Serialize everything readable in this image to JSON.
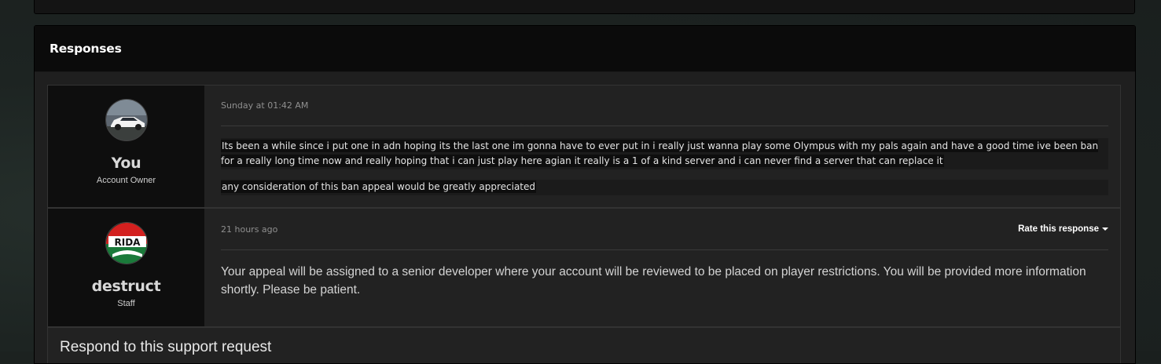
{
  "section": {
    "title": "Responses"
  },
  "posts": [
    {
      "author": {
        "name": "You",
        "role": "Account Owner"
      },
      "timestamp": "Sunday at 01:42 AM",
      "paragraphs": [
        "Its been a while since i put one in adn hoping its the last one im gonna have to ever put in i really just wanna play some Olympus with my pals again and have a good time ive been ban for a really long time now and really hoping that i can just play here agian it really is a 1 of a kind server and i can never find a server that can replace it",
        "any consideration of this ban appeal would be greatly appreciated"
      ]
    },
    {
      "author": {
        "name": "destruct",
        "role": "Staff"
      },
      "timestamp": "21 hours ago",
      "rate_label": "Rate this response",
      "text": "Your appeal will be assigned to a senior developer where your account will be reviewed to be placed on player restrictions. You will be provided more information shortly. Please be patient."
    }
  ],
  "respond": {
    "title": "Respond to this support request"
  },
  "icons": {
    "rate_caret": "caret-down-icon"
  }
}
